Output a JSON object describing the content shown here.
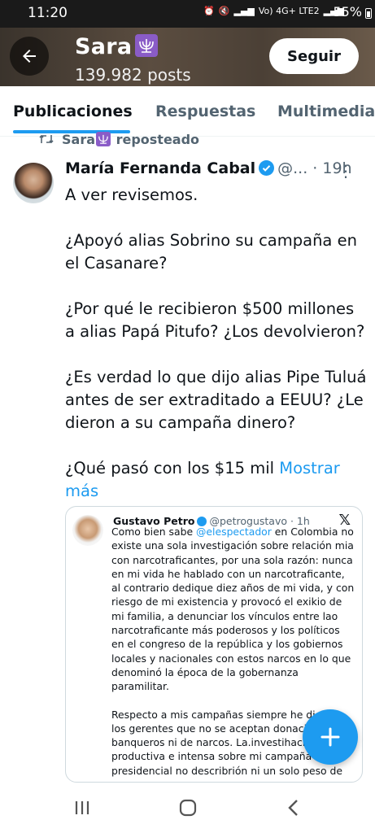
{
  "status": {
    "time": "11:20",
    "network_label": "Vo) 4G+ LTE2",
    "battery": "55%"
  },
  "profile": {
    "name": "Sara",
    "posts": "139.982 posts",
    "follow_label": "Seguir"
  },
  "tabs": [
    {
      "label": "Publicaciones",
      "active": true
    },
    {
      "label": "Respuestas",
      "active": false
    },
    {
      "label": "Multimedia",
      "active": false
    }
  ],
  "repost": {
    "who": "Sara",
    "label": "reposteado"
  },
  "tweet": {
    "author_name": "María Fernanda Cabal",
    "handle": "@...",
    "time": "· 19h",
    "paragraphs": [
      "A ver revisemos.",
      "¿Apoyó alias Sobrino su campaña en el Casanare?",
      "¿Por qué le recibieron $500 millones a alias Papá Pitufo? ¿Los devolvieron?",
      "¿Es verdad lo que dijo alias Pipe Tuluá antes de ser extraditado a EEUU? ¿Le dieron a su campaña dinero?",
      "¿Qué pasó con los $15 mil"
    ],
    "show_more": "Mostrar más"
  },
  "embedded": {
    "author_name": "Gustavo Petro",
    "handle": "@petrogustavo",
    "time": "· 1h",
    "p1_before": "Como bien sabe ",
    "p1_mention": "@elespectador",
    "p1_after": " en Colombia no existe una sola investigación sobre relación mia con narcotraficantes, por una sola razón: nunca en mi vida he  hablado con un narcotraficante, al contrario dedique diez años de mi vida, y con riesgo de mi existencia y provocó el exikio de mi familia, a denunciar los vínculos entre lao narcotraficante más poderosos y los políticos en el congreso de la república y los gobiernos locales y nacionales con estos narcos en lo que denominó la época de la gobernanza paramilitar.",
    "p2": "Respecto a mis campañas siempre he dicho a los gerentes que no se aceptan donaciones de banqueros ni de narcos. La.investihación productiva e intensa sobre mi campaña presidencial no describrión ni un solo peso de"
  },
  "colors": {
    "accent": "#1d9bf0",
    "text": "#0f1419",
    "muted": "#536471"
  },
  "icons": {
    "back": "arrow-left-icon",
    "repost": "repost-icon",
    "verified": "verified-badge-icon",
    "more": "more-vertical-icon",
    "x": "x-logo-icon",
    "compose": "plus-icon",
    "nav": [
      "recents-icon",
      "home-icon",
      "back-nav-icon"
    ]
  }
}
